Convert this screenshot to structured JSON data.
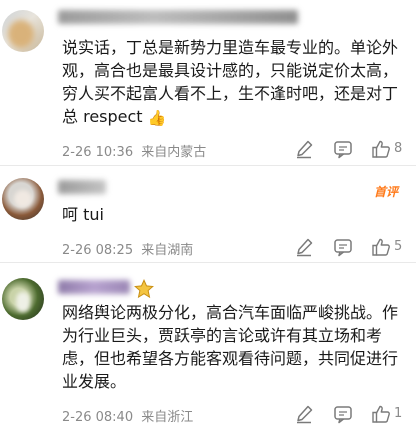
{
  "colors": {
    "accent": "#ff7a1a",
    "meta_text": "#8a8a8a",
    "body_text": "#1a1a1a"
  },
  "comments": [
    {
      "text": "说实话，丁总是新势力里造车最专业的。单论外观，高合也是最具设计感的，只能说定价太高，穷人买不起富人看不上，生不逢时吧，还是对丁总 respect",
      "emoji_icon": "thumbs-up-emoji",
      "emoji": "👍",
      "time": "2-26 10:36",
      "location": "来自内蒙古",
      "likes": "8"
    },
    {
      "badge": "首评",
      "text": "呵 tui",
      "time": "2-26 08:25",
      "location": "来自湖南",
      "likes": "5"
    },
    {
      "text": "网络舆论两极分化，高合汽车面临严峻挑战。作为行业巨头，贾跃亭的言论或许有其立场和考虑，但也希望各方能客观看待问题，共同促进行业发展。",
      "time": "2-26 08:40",
      "location": "来自浙江",
      "likes": "1"
    }
  ]
}
